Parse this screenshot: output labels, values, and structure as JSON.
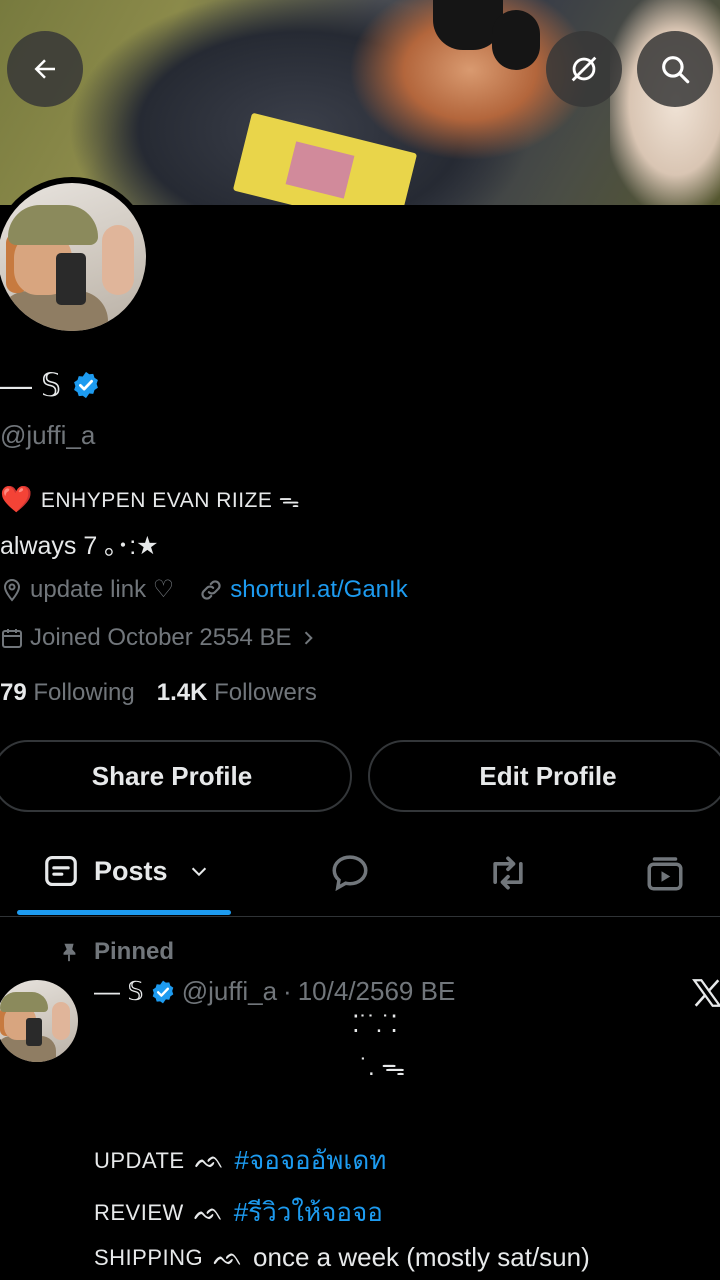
{
  "header": {
    "back_icon": "arrow-left-icon",
    "grok_icon": "grok-icon",
    "search_icon": "search-icon"
  },
  "profile": {
    "display_name": "— 𝕊",
    "verified": true,
    "handle": "@juffi_a",
    "bio_line1_emoji": "❤️",
    "bio_line1": "ENHYPEN EVAN RIIZE ᯓ",
    "bio_line2": "always 7 ｡･:★",
    "location": "update link ♡",
    "website": "shorturl.at/GanIk",
    "joined": "Joined October 2554 BE",
    "following_count": "79",
    "following_label": "Following",
    "followers_count": "1.4K",
    "followers_label": "Followers"
  },
  "buttons": {
    "share": "Share Profile",
    "edit": "Edit Profile"
  },
  "tabs": {
    "posts_label": "Posts"
  },
  "post": {
    "pinned_label": "Pinned",
    "author_name": "— 𝕊",
    "author_handle": "@juffi_a",
    "separator": "·",
    "date": "10/4/2569 BE",
    "kaomoji_line1": "⁚˙˙.˙⁚",
    "kaomoji_line2": "˙. ᯓ",
    "lines": [
      {
        "key": "UPDATE",
        "sym": "ᨒ",
        "value": "#จอจออัพเดท",
        "is_tag": true
      },
      {
        "key": "REVIEW",
        "sym": "ᨒ",
        "value": "#รีวิวให้จอจอ",
        "is_tag": true
      },
      {
        "key": "SHIPPING",
        "sym": "ᨒ",
        "value": "once a week (mostly sat/sun)",
        "is_tag": false
      }
    ]
  },
  "colors": {
    "accent": "#1d9bf0",
    "muted": "#71767b",
    "text": "#e7e9ea",
    "background": "#000000",
    "border": "#333639"
  }
}
